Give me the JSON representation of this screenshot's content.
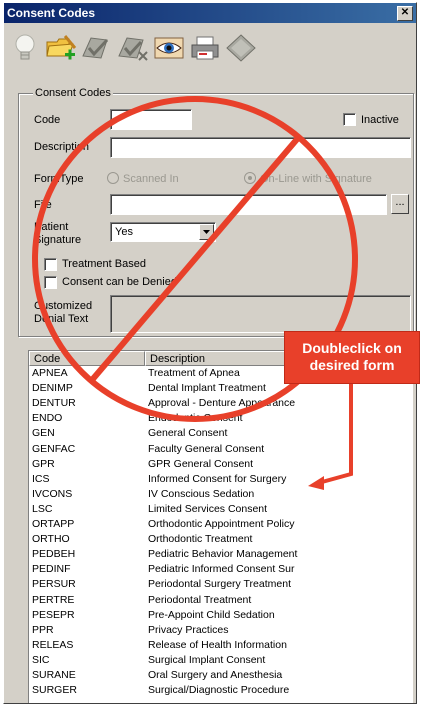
{
  "window": {
    "title": "Consent Codes",
    "close_glyph": "✕"
  },
  "toolbar": {
    "buttons": [
      {
        "name": "lightbulb-icon"
      },
      {
        "name": "add-folder-icon"
      },
      {
        "name": "approve-icon"
      },
      {
        "name": "reject-icon"
      },
      {
        "name": "view-eye-icon"
      },
      {
        "name": "printer-icon"
      },
      {
        "name": "diamond-icon"
      }
    ]
  },
  "form": {
    "group_label": "Consent Codes",
    "code_label": "Code",
    "code_value": "",
    "inactive_label": "Inactive",
    "description_label": "Description",
    "description_value": "",
    "formtype_label": "FormType",
    "formtype_options": [
      "Scanned In",
      "On-Line with Signature"
    ],
    "file_label": "File",
    "file_value": "",
    "browse_label": "...",
    "patient_sig_label_1": "Patient",
    "patient_sig_label_2": "Signature",
    "patient_sig_value": "Yes",
    "treatment_based_label": "Treatment Based",
    "consent_denied_label": "Consent can be Denied",
    "denial_label_1": "Customized",
    "denial_label_2": "Denial Text",
    "denial_value": ""
  },
  "list": {
    "columns": [
      "Code",
      "Description"
    ],
    "rows": [
      [
        "APNEA",
        "Treatment of Apnea"
      ],
      [
        "DENIMP",
        "Dental Implant Treatment"
      ],
      [
        "DENTUR",
        "Approval - Denture Appearance"
      ],
      [
        "ENDO",
        "Endodontic Consent"
      ],
      [
        "GEN",
        "General Consent"
      ],
      [
        "GENFAC",
        "Faculty General Consent"
      ],
      [
        "GPR",
        "GPR General Consent"
      ],
      [
        "ICS",
        "Informed Consent for Surgery"
      ],
      [
        "IVCONS",
        "IV Conscious Sedation"
      ],
      [
        "LSC",
        "Limited Services Consent"
      ],
      [
        "ORTAPP",
        "Orthodontic Appointment Policy"
      ],
      [
        "ORTHO",
        "Orthodontic Treatment"
      ],
      [
        "PEDBEH",
        "Pediatric Behavior Management"
      ],
      [
        "PEDINF",
        "Pediatric Informed Consent Sur"
      ],
      [
        "PERSUR",
        "Periodontal Surgery Treatment"
      ],
      [
        "PERTRE",
        "Periodontal Treatment"
      ],
      [
        "PESEPR",
        "Pre-Appoint Child Sedation"
      ],
      [
        "PPR",
        "Privacy Practices"
      ],
      [
        "RELEAS",
        "Release of Health Information"
      ],
      [
        "SIC",
        "Surgical Implant Consent"
      ],
      [
        "SURANE",
        "Oral Surgery and Anesthesia"
      ],
      [
        "SURGER",
        "Surgical/Diagnostic Procedure"
      ]
    ]
  },
  "annotation": {
    "callout_line1": "Doubleclick on",
    "callout_line2": "desired form",
    "color": "#e8402a"
  }
}
